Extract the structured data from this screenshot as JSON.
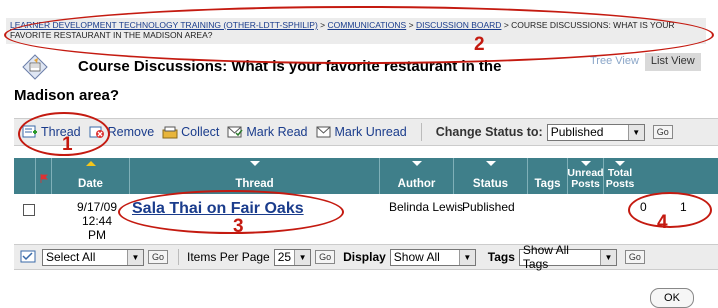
{
  "breadcrumb": {
    "items": [
      "LEARNER DEVELOPMENT TECHNOLOGY TRAINING (OTHER-LDTT-SPHILIP)",
      "COMMUNICATIONS",
      "DISCUSSION BOARD"
    ],
    "current": "COURSE DISCUSSIONS: WHAT IS YOUR FAVORITE RESTAURANT IN THE MADISON AREA?",
    "separator": ">"
  },
  "view_tabs": {
    "tree": "Tree View",
    "list": "List View"
  },
  "title": {
    "line1": "Course Discussions: What is your favorite restaurant in the",
    "line2": "Madison area?"
  },
  "toolbar": {
    "thread": "Thread",
    "remove": "Remove",
    "collect": "Collect",
    "mark_read": "Mark Read",
    "mark_unread": "Mark Unread",
    "change_status": "Change Status to:",
    "status_value": "Published",
    "go": "Go"
  },
  "table": {
    "headers": {
      "date": "Date",
      "thread": "Thread",
      "author": "Author",
      "status": "Status",
      "tags": "Tags",
      "unread": "Unread Posts",
      "total": "Total Posts"
    },
    "rows": [
      {
        "date": "9/17/09",
        "time": "12:44 PM",
        "thread": "Sala Thai on Fair Oaks",
        "author": "Belinda Lewis",
        "status": "Published",
        "unread": "0",
        "total": "1"
      }
    ]
  },
  "bottom": {
    "select_all": "Select All",
    "go": "Go",
    "items_per_page_label": "Items Per Page",
    "items_per_page": "25",
    "display_label": "Display",
    "display_value": "Show All",
    "tags_label": "Tags",
    "tags_value": "Show All Tags"
  },
  "ok": "OK",
  "annotations": {
    "n1": "1",
    "n2": "2",
    "n3": "3",
    "n4": "4"
  },
  "colors": {
    "header_teal": "#3f7f8a",
    "annotation_red": "#c41a10",
    "link_blue": "#1a3c8c"
  }
}
